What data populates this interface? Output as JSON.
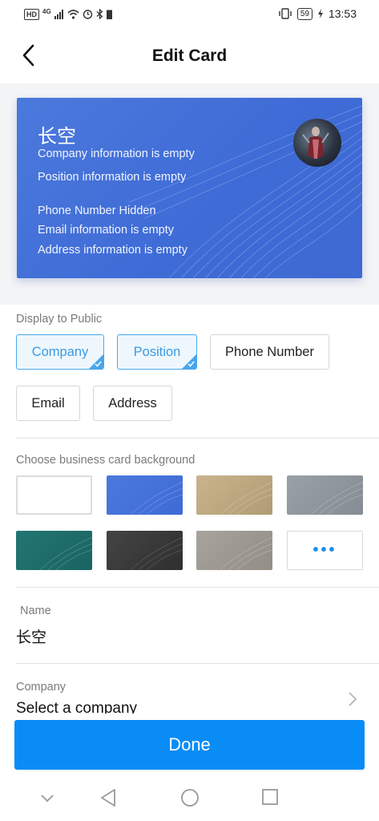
{
  "status_bar": {
    "left_badge": "HD",
    "network": "4G",
    "battery": "59",
    "time": "13:53"
  },
  "header": {
    "title": "Edit Card",
    "back_icon": "chevron-left-icon"
  },
  "card_preview": {
    "name": "长空",
    "company": "Company information is empty",
    "position": "Position information is empty",
    "phone": "Phone Number Hidden",
    "email": "Email information is empty",
    "address": "Address information is empty",
    "background_color": "#4272d8"
  },
  "display_public": {
    "label": "Display to Public",
    "options": [
      {
        "label": "Company",
        "selected": true
      },
      {
        "label": "Position",
        "selected": true
      },
      {
        "label": "Phone Number",
        "selected": false
      },
      {
        "label": "Email",
        "selected": false
      },
      {
        "label": "Address",
        "selected": false
      }
    ]
  },
  "backgrounds": {
    "label": "Choose business card background",
    "swatches": [
      {
        "name": "white",
        "color": "#ffffff"
      },
      {
        "name": "blue",
        "color": "#4272d8"
      },
      {
        "name": "gold",
        "color": "#bfa97f"
      },
      {
        "name": "gray",
        "color": "#8e949c"
      },
      {
        "name": "teal",
        "color": "#1f6e6c"
      },
      {
        "name": "dark",
        "color": "#3a3a3a"
      },
      {
        "name": "warm-gray",
        "color": "#9c968f"
      }
    ],
    "more_label": "•••"
  },
  "form": {
    "name_label": "Name",
    "name_value": "长空",
    "company_label": "Company",
    "company_value": "Select a company"
  },
  "done_label": "Done",
  "colors": {
    "accent": "#0a8cf7",
    "selected_chip": "#4aa6ec"
  }
}
